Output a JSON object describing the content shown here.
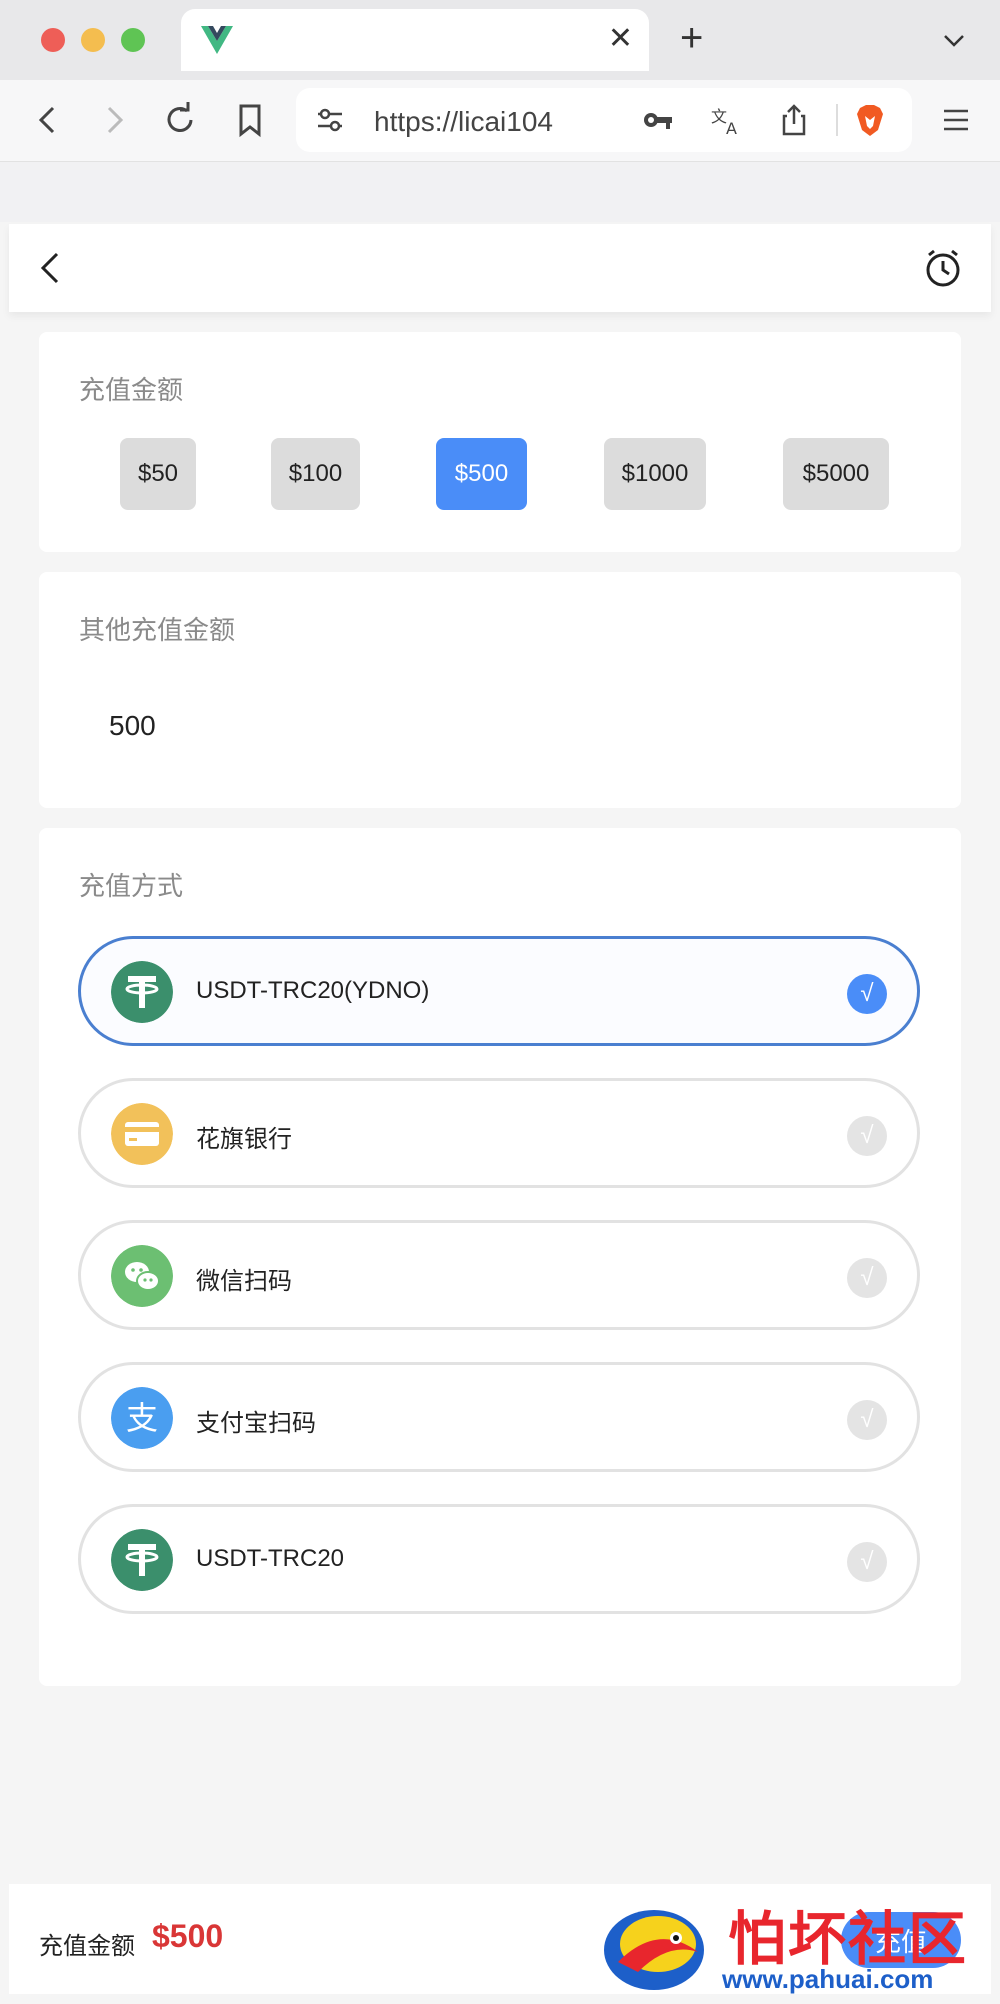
{
  "browser": {
    "url": "https://licai104"
  },
  "sections": {
    "amount_title": "充值金额",
    "other_title": "其他充值金额",
    "method_title": "充值方式"
  },
  "amounts": [
    "$50",
    "$100",
    "$500",
    "$1000",
    "$5000"
  ],
  "selected_amount": "$500",
  "other_amount_value": "500",
  "methods": [
    {
      "label": "USDT-TRC20(YDNO)",
      "icon": "tether-icon",
      "selected": true
    },
    {
      "label": "花旗银行",
      "icon": "bank-card-icon",
      "selected": false
    },
    {
      "label": "微信扫码",
      "icon": "wechat-icon",
      "selected": false
    },
    {
      "label": "支付宝扫码",
      "icon": "alipay-icon",
      "selected": false
    },
    {
      "label": "USDT-TRC20",
      "icon": "tether-icon",
      "selected": false
    }
  ],
  "check_glyph": "√",
  "footer": {
    "label": "充值金额",
    "value": "$500",
    "button": "充值"
  },
  "watermark": {
    "text": "怕坏社区",
    "url": "www.pahuai.com"
  },
  "colors": {
    "accent": "#4a8df8",
    "price": "#d93636",
    "tether": "#3b8f6c",
    "bank": "#f2c15a",
    "wechat": "#6cbf72",
    "alipay": "#4a9ef0"
  }
}
